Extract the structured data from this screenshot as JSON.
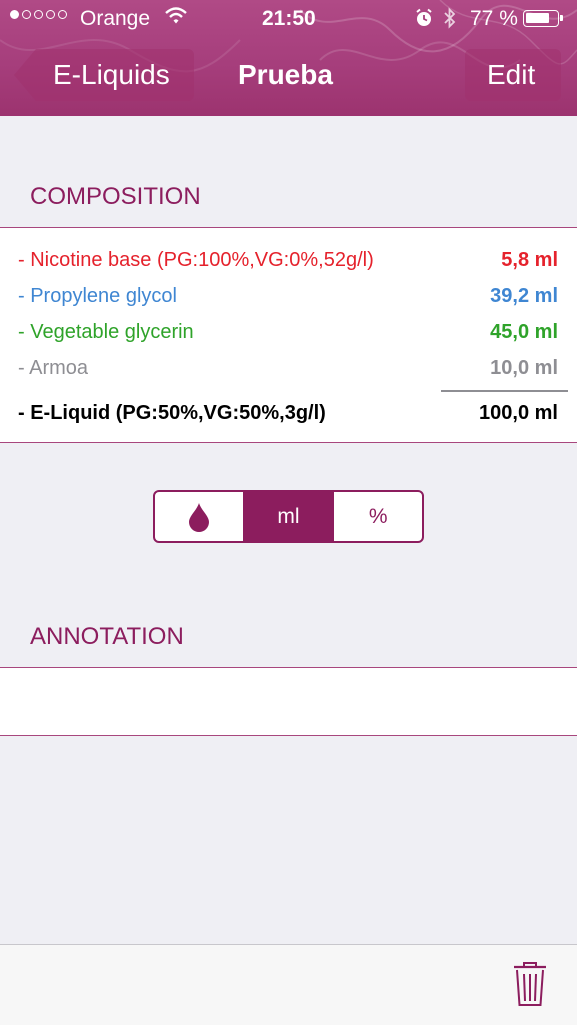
{
  "status_bar": {
    "carrier": "Orange",
    "time": "21:50",
    "battery": "77 %",
    "signal_bars_filled": 1,
    "signal_bars_total": 5,
    "battery_level": 0.77,
    "icons": [
      "wifi-icon",
      "alarm-icon",
      "bluetooth-icon",
      "battery-icon"
    ]
  },
  "nav": {
    "back_label": "E-Liquids",
    "title": "Prueba",
    "edit_label": "Edit"
  },
  "composition": {
    "header": "COMPOSITION",
    "items": [
      {
        "label": "- Nicotine base (PG:100%,VG:0%,52g/l)",
        "value": "5,8 ml",
        "color": "#e5222c"
      },
      {
        "label": "- Propylene glycol",
        "value": "39,2 ml",
        "color": "#3f86d2"
      },
      {
        "label": "- Vegetable glycerin",
        "value": "45,0 ml",
        "color": "#2fa32a"
      },
      {
        "label": "- Armoa",
        "value": "10,0 ml",
        "color": "#8e8e93"
      }
    ],
    "total": {
      "label": "- E-Liquid (PG:50%,VG:50%,3g/l)",
      "value": "100,0 ml",
      "color": "#000000"
    }
  },
  "unit_selector": {
    "options": [
      {
        "icon": "drop-icon",
        "label": ""
      },
      {
        "icon": "",
        "label": "ml"
      },
      {
        "icon": "",
        "label": "%"
      }
    ],
    "selected": "ml"
  },
  "annotation": {
    "header": "ANNOTATION",
    "text": ""
  },
  "toolbar": {
    "icons": [
      "trash-icon"
    ]
  },
  "colors": {
    "accent": "#8c1d5e",
    "header_bg": "#a63e7c",
    "page_bg": "#efeff4"
  }
}
